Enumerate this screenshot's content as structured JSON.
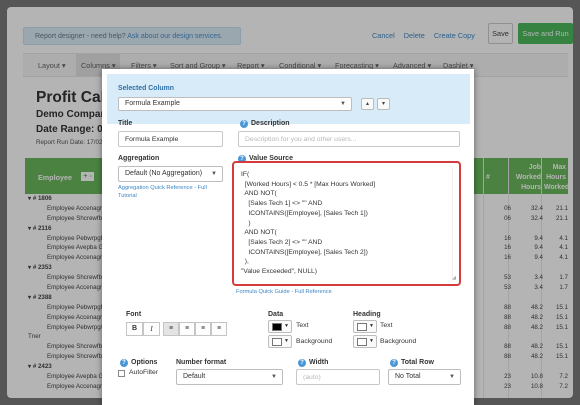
{
  "topbar": {
    "help_text": "Report designer - need help?",
    "help_link": "Ask about our design services.",
    "links": [
      "Cancel",
      "Delete",
      "Create Copy"
    ],
    "save": "Save",
    "save_and_run": "Save and Run"
  },
  "menu": [
    "Layout ▾",
    "Columns ▾",
    "Filters ▾",
    "Sort and Group ▾",
    "Report ▾",
    "Conditional ▾",
    "Forecasting ▾",
    "Advanced ▾",
    "Dashlet ▾"
  ],
  "report": {
    "title": "Profit Calc",
    "company": "Demo Company",
    "date_range": "Date Range: 04/0",
    "run_date": "Report Run Date: 17/02",
    "header": {
      "employee": "Employee",
      "toggle": "+ -",
      "hash": "#",
      "job_worked": "Job\nWorked\nHours",
      "max_worked": "Max\nHours\nWorked"
    },
    "rows": [
      {
        "type": "group",
        "label": "▾ # 1806",
        "c1": "",
        "c2": "",
        "c3": ""
      },
      {
        "type": "emp",
        "label": "Employee Accenagrar",
        "c1": "06",
        "c2": "32.4",
        "c3": "21.1"
      },
      {
        "type": "emp",
        "label": "Employee Shcrewfbe",
        "c1": "06",
        "c2": "32.4",
        "c3": "21.1"
      },
      {
        "type": "group",
        "label": "▾ # 2116",
        "c1": "",
        "c2": "",
        "c3": ""
      },
      {
        "type": "emp",
        "label": "Employee Pebwrpgf -",
        "c1": "16",
        "c2": "9.4",
        "c3": "4.1"
      },
      {
        "type": "emp",
        "label": "Employee Avepba Grp",
        "c1": "16",
        "c2": "9.4",
        "c3": "4.1"
      },
      {
        "type": "emp",
        "label": "Employee Accenagrar",
        "c1": "16",
        "c2": "9.4",
        "c3": "4.1"
      },
      {
        "type": "group",
        "label": "▾ # 2353",
        "c1": "",
        "c2": "",
        "c3": ""
      },
      {
        "type": "emp",
        "label": "Employee Shcrewfbe -",
        "c1": "53",
        "c2": "3.4",
        "c3": "1.7"
      },
      {
        "type": "emp",
        "label": "Employee Accenagrar",
        "c1": "53",
        "c2": "3.4",
        "c3": "1.7"
      },
      {
        "type": "group",
        "label": "▾ # 2388",
        "c1": "",
        "c2": "",
        "c3": ""
      },
      {
        "type": "emp",
        "label": "Employee Pebwrpgf -",
        "c1": "88",
        "c2": "48.2",
        "c3": "15.1"
      },
      {
        "type": "emp",
        "label": "Employee Accenagrar",
        "c1": "88",
        "c2": "48.2",
        "c3": "15.1"
      },
      {
        "type": "emp",
        "label": "Employee Pebwrpg/Ff",
        "c1": "88",
        "c2": "48.2",
        "c3": "15.1"
      },
      {
        "type": "tner",
        "label": "Tner",
        "c1": "",
        "c2": "",
        "c3": ""
      },
      {
        "type": "emp",
        "label": "Employee Shcrewfbe -",
        "c1": "88",
        "c2": "48.2",
        "c3": "15.1"
      },
      {
        "type": "emp",
        "label": "Employee Shcrewfbe -",
        "c1": "88",
        "c2": "48.2",
        "c3": "15.1"
      },
      {
        "type": "group",
        "label": "▾ # 2423",
        "c1": "",
        "c2": "",
        "c3": ""
      },
      {
        "type": "emp",
        "label": "Employee Avepba Grp",
        "c1": "23",
        "c2": "10.8",
        "c3": "7.2"
      },
      {
        "type": "emp",
        "label": "Employee Accenagrar",
        "c1": "23",
        "c2": "10.8",
        "c3": "7.2"
      }
    ]
  },
  "dialog": {
    "selected_column_label": "Selected Column",
    "selected_column_value": "Formula Example",
    "up": "▴",
    "down": "▾",
    "title_label": "Title",
    "title_value": "Formula Example",
    "description_label": "Description",
    "description_placeholder": "Description for you and other users...",
    "aggregation_label": "Aggregation",
    "aggregation_value": "Default (No Aggregation)",
    "aggregation_help": "Aggregation Quick Reference - Full Tutorial",
    "value_source_label": "Value Source",
    "value_source_code": "IF(\n  [Worked Hours] < 0.5 * [Max Hours Worked]\n  AND NOT(\n    [Sales Tech 1] <> \"\" AND\n    ICONTAINS([Employee], [Sales Tech 1])\n    )\n  AND NOT(\n    [Sales Tech 2] <> \"\" AND\n    ICONTAINS([Employee], [Sales Tech 2])\n  ),\n\"Value Exceeded\", NULL)",
    "formula_help": "Formula Quick Guide - Full Reference",
    "font_label": "Font",
    "font_buttons": [
      "B",
      "I",
      "≡",
      "≡",
      "≡",
      "≡"
    ],
    "data_label": "Data",
    "text_label": "Text",
    "background_label": "Background",
    "heading_label": "Heading",
    "heading_text_label": "Text",
    "heading_background_label": "Background",
    "options_label": "Options",
    "autofilter_label": "AutoFilter",
    "number_format_label": "Number format",
    "number_format_value": "Default",
    "width_label": "Width",
    "width_placeholder": "(auto)",
    "total_row_label": "Total Row",
    "total_row_value": "No Total"
  }
}
